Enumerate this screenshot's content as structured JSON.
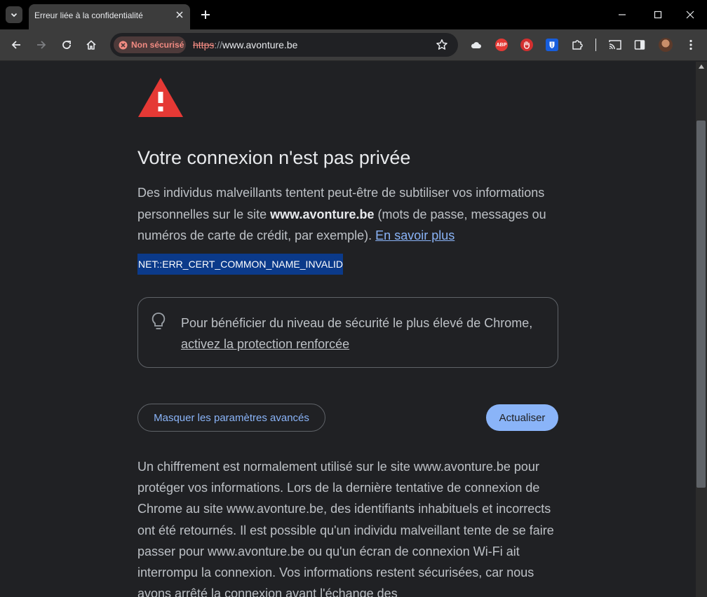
{
  "tab": {
    "title": "Erreur liée à la confidentialité"
  },
  "toolbar": {
    "security_chip": "Non sécurisé",
    "url_scheme": "https",
    "url_separator": "://",
    "url_host": "www.avonture.be"
  },
  "extensions": [
    "cloud-icon",
    "adblock-plus-icon",
    "hand-stop-icon",
    "bitwarden-icon",
    "puzzle-icon"
  ],
  "extensions_abp_label": "ABP",
  "page": {
    "heading": "Votre connexion n'est pas privée",
    "explanation_before": "Des individus malveillants tentent peut-être de subtiliser vos informations personnelles sur le site ",
    "explanation_site": "www.avonture.be",
    "explanation_after": " (mots de passe, messages ou numéros de carte de crédit, par exemple). ",
    "learn_more": "En savoir plus",
    "error_code": "NET::ERR_CERT_COMMON_NAME_INVALID",
    "tip_text": "Pour bénéficier du niveau de sécurité le plus élevé de Chrome, ",
    "tip_link": "activez la protection renforcée",
    "advanced_button": "Masquer les paramètres avancés",
    "reload_button": "Actualiser",
    "details": "Un chiffrement est normalement utilisé sur le site www.avonture.be pour protéger vos informations. Lors de la dernière tentative de connexion de Chrome au site www.avonture.be, des identifiants inhabituels et incorrects ont été retournés. Il est possible qu'un individu malveillant tente de se faire passer pour www.avonture.be ou qu'un écran de connexion Wi-Fi ait interrompu la connexion. Vos informations restent sécurisées, car nous avons arrêté la connexion avant l'échange des"
  },
  "colors": {
    "warning_red": "#e53935",
    "link_blue": "#8ab4f8",
    "selection_blue": "#0b3a8a"
  }
}
